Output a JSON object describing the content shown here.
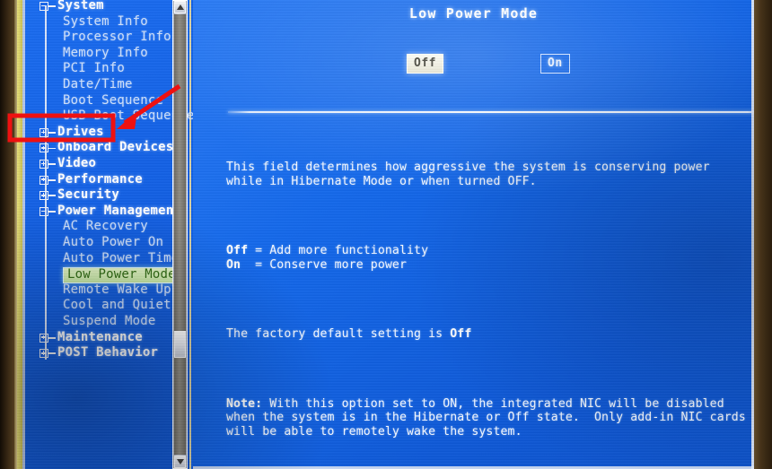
{
  "screen": {
    "title": "Low Power Mode",
    "background_color": "#1161e8",
    "text_color": "#f4f8ff"
  },
  "sidebar": {
    "scrollbar": {
      "up_arrow": "scroll-up",
      "down_arrow": "scroll-down"
    },
    "items": [
      {
        "label": "System",
        "level": "parent",
        "node": "minus",
        "selected": false
      },
      {
        "label": "System Info",
        "level": "child",
        "node": "none",
        "selected": false
      },
      {
        "label": "Processor Info",
        "level": "child",
        "node": "none",
        "selected": false
      },
      {
        "label": "Memory Info",
        "level": "child",
        "node": "none",
        "selected": false
      },
      {
        "label": "PCI Info",
        "level": "child",
        "node": "none",
        "selected": false
      },
      {
        "label": "Date/Time",
        "level": "child",
        "node": "none",
        "selected": false
      },
      {
        "label": "Boot Sequence",
        "level": "child",
        "node": "none",
        "selected": false
      },
      {
        "label": "USB Boot Sequence",
        "level": "child",
        "node": "none",
        "selected": false
      },
      {
        "label": "Drives",
        "level": "parent",
        "node": "plus",
        "selected": false
      },
      {
        "label": "Onboard Devices",
        "level": "parent",
        "node": "plus",
        "selected": false
      },
      {
        "label": "Video",
        "level": "parent",
        "node": "plus",
        "selected": false
      },
      {
        "label": "Performance",
        "level": "parent",
        "node": "plus",
        "selected": false
      },
      {
        "label": "Security",
        "level": "parent",
        "node": "plus",
        "selected": false
      },
      {
        "label": "Power Management",
        "level": "parent",
        "node": "minus",
        "selected": false
      },
      {
        "label": "AC Recovery",
        "level": "child",
        "node": "none",
        "selected": false
      },
      {
        "label": "Auto Power On",
        "level": "child",
        "node": "none",
        "selected": false
      },
      {
        "label": "Auto Power Time",
        "level": "child",
        "node": "none",
        "selected": false
      },
      {
        "label": "Low Power Mode",
        "level": "child",
        "node": "none",
        "selected": true
      },
      {
        "label": "Remote Wake Up",
        "level": "child",
        "node": "none",
        "selected": false
      },
      {
        "label": "Cool and Quiet",
        "level": "child",
        "node": "none",
        "selected": false
      },
      {
        "label": "Suspend Mode",
        "level": "child",
        "node": "none",
        "selected": false
      },
      {
        "label": "Maintenance",
        "level": "parent",
        "node": "plus",
        "selected": false
      },
      {
        "label": "POST Behavior",
        "level": "parent",
        "node": "plus",
        "selected": false
      }
    ]
  },
  "main": {
    "title": "Low Power Mode",
    "options": [
      {
        "label": "Off",
        "selected": true
      },
      {
        "label": "On",
        "selected": false
      }
    ],
    "help": {
      "paragraph1": "This field determines how aggressive the system is conserving power\nwhile in Hibernate Mode or when turned OFF.",
      "legend_off_key": "Off",
      "legend_off_text": " = Add more functionality",
      "legend_on_key": "On",
      "legend_on_text": "  = Conserve more power",
      "default_prefix": "The factory default setting is ",
      "default_value": "Off",
      "note_key": "Note:",
      "note_text": " With this option set to ON, the integrated NIC will be disabled\nwhen the system is in the Hibernate or Off state.  Only add-in NIC cards\nwill be able to remotely wake the system."
    }
  },
  "annotations": {
    "color": "#ee1111",
    "highlight_box_target": "Drives",
    "arrow_points_to": "Drives"
  }
}
